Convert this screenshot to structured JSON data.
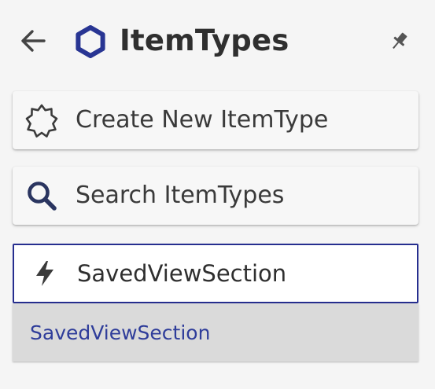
{
  "header": {
    "title": "ItemTypes",
    "back_icon": "arrow-left-icon",
    "title_icon": "hexagon-icon",
    "pin_icon": "pin-icon",
    "accent_color": "#283593"
  },
  "actions": {
    "create_label": "Create New ItemType",
    "create_icon": "badge-outline-icon",
    "search_label": "Search ItemTypes",
    "search_icon": "search-icon"
  },
  "filter": {
    "icon": "lightning-bolt-icon",
    "value": "SavedViewSection",
    "border_color": "#262e8f"
  },
  "suggestions": {
    "items": [
      "SavedViewSection"
    ],
    "text_color": "#2f3d9a",
    "background": "#dadada"
  }
}
